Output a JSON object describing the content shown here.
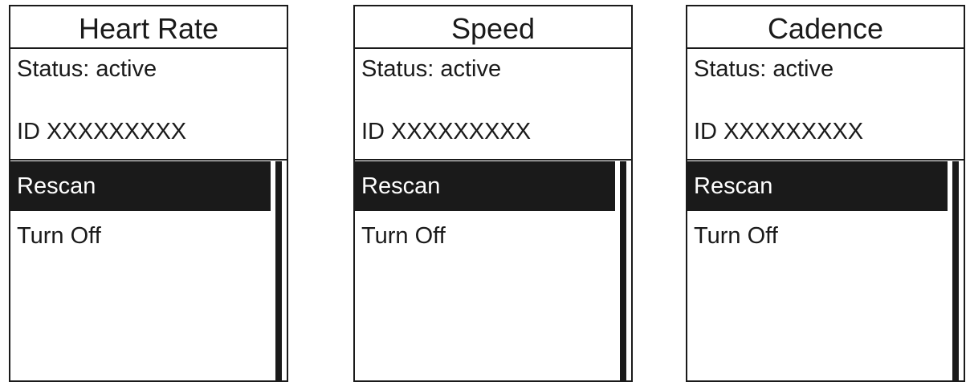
{
  "screens": [
    {
      "title": "Heart Rate",
      "status": "Status: active",
      "id_text": "ID XXXXXXXXX",
      "menu": [
        {
          "label": "Rescan",
          "selected": true
        },
        {
          "label": "Turn Off",
          "selected": false
        }
      ]
    },
    {
      "title": "Speed",
      "status": "Status: active",
      "id_text": "ID XXXXXXXXX",
      "menu": [
        {
          "label": "Rescan",
          "selected": true
        },
        {
          "label": "Turn Off",
          "selected": false
        }
      ]
    },
    {
      "title": "Cadence",
      "status": "Status: active",
      "id_text": "ID XXXXXXXXX",
      "menu": [
        {
          "label": "Rescan",
          "selected": true
        },
        {
          "label": "Turn Off",
          "selected": false
        }
      ]
    }
  ],
  "colors": {
    "foreground": "#1a1a1a",
    "background": "#ffffff",
    "selected_text": "#ffffff"
  }
}
